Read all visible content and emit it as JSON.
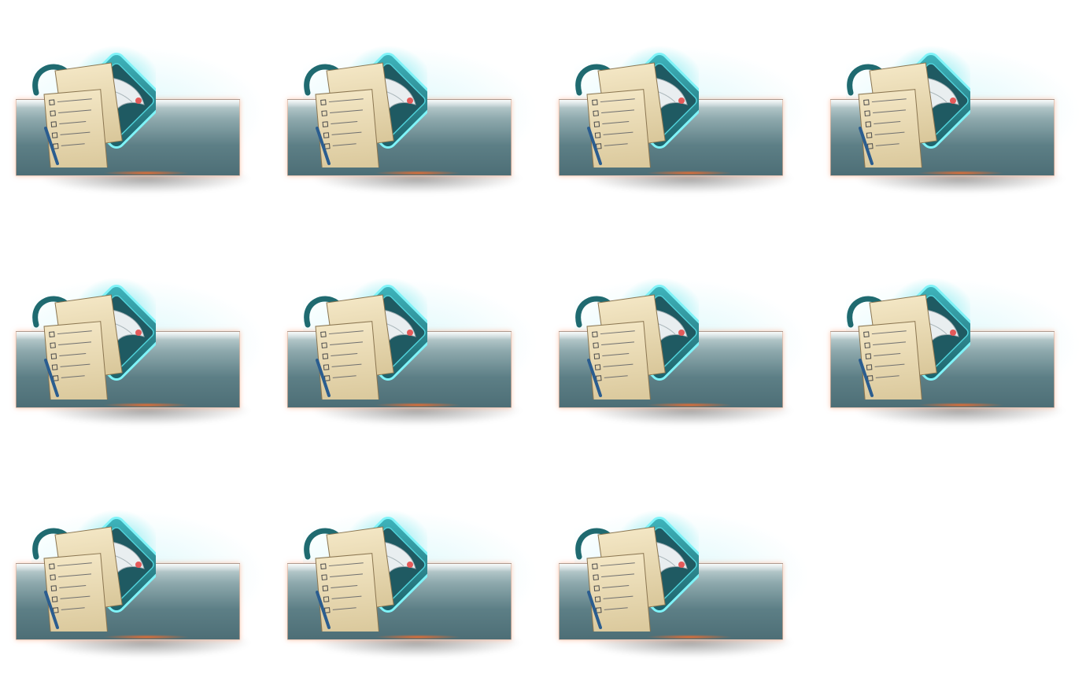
{
  "sprite_sheet": {
    "frames": [
      {
        "id": 1
      },
      {
        "id": 2
      },
      {
        "id": 3
      },
      {
        "id": 4
      },
      {
        "id": 5
      },
      {
        "id": 6
      },
      {
        "id": 7
      },
      {
        "id": 8
      },
      {
        "id": 9
      },
      {
        "id": 10
      },
      {
        "id": 11
      }
    ],
    "columns": 4,
    "icon": "mail-documents-dove-icon",
    "colors": {
      "glow": "#5ee3ea",
      "frame": "#2a7f86",
      "paper": "#ead9b0",
      "banner_top": "#c9d9da",
      "banner_bottom": "#4d6e76",
      "accent": "#ff7a3a"
    }
  }
}
